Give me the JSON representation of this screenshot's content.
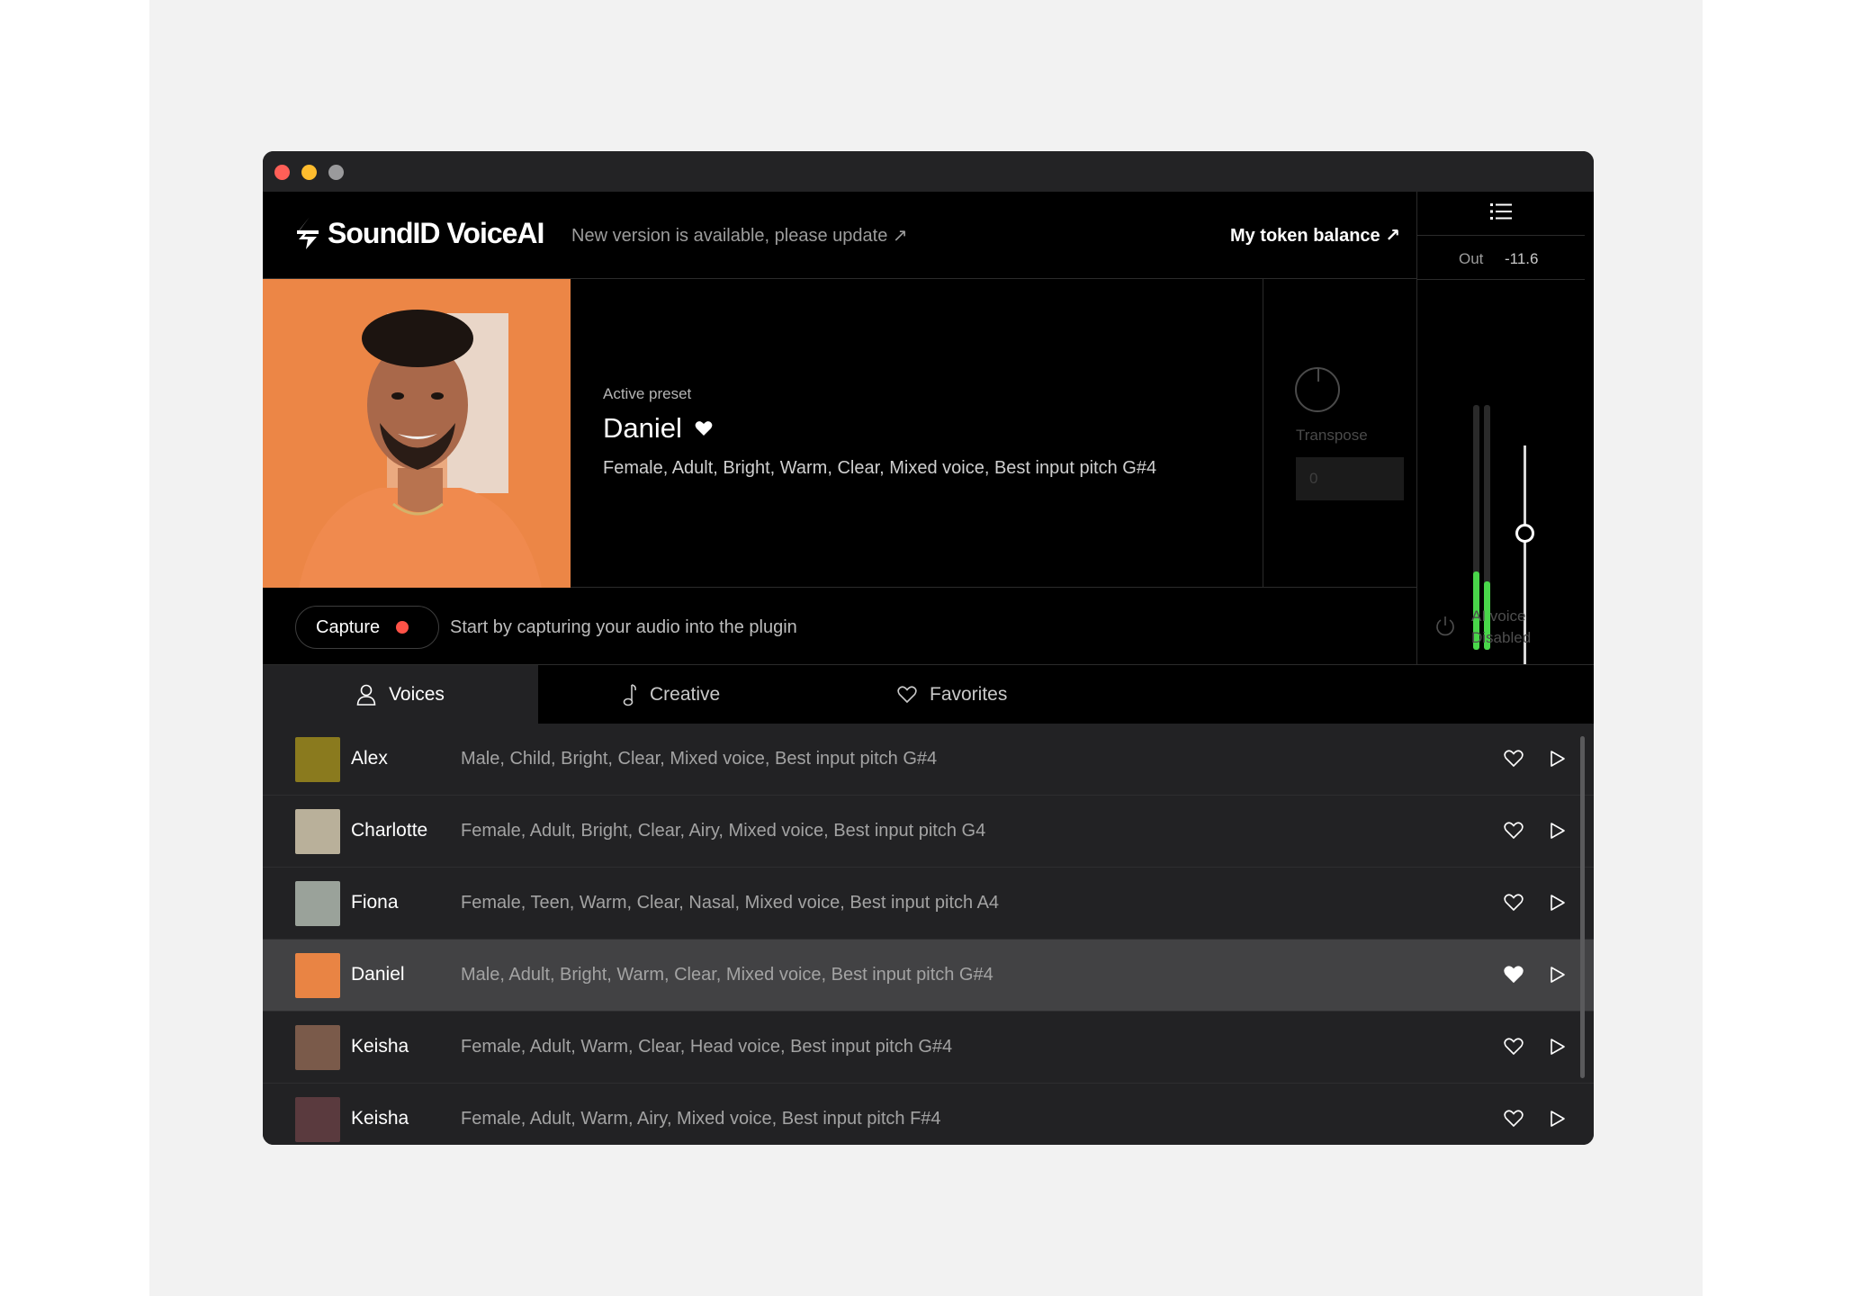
{
  "app": {
    "logo_text": "SoundID VoiceAI",
    "update_notice": "New version is available, please update",
    "token_balance": "My token balance"
  },
  "output": {
    "label": "Out",
    "value": "-11.6",
    "meter_levels": [
      0.32,
      0.28
    ],
    "fader_level": 0.64
  },
  "preset": {
    "label": "Active preset",
    "name": "Daniel",
    "tags": "Female, Adult, Bright, Warm, Clear, Mixed voice, Best input pitch  G#4"
  },
  "transpose": {
    "label": "Transpose",
    "value": "0"
  },
  "capture": {
    "button_label": "Capture",
    "hint": "Start by capturing your audio into the plugin"
  },
  "ai_voice": {
    "title": "AI voice",
    "status": "Disabled"
  },
  "tabs": [
    {
      "label": "Voices",
      "icon": "person-icon",
      "active": true
    },
    {
      "label": "Creative",
      "icon": "music-note-icon",
      "active": false
    },
    {
      "label": "Favorites",
      "icon": "heart-icon",
      "active": false
    }
  ],
  "voices": [
    {
      "name": "Alex",
      "tags": "Male, Child, Bright, Clear, Mixed voice, Best input pitch G#4",
      "favorite": false,
      "active": false,
      "color": "#8a7a1e"
    },
    {
      "name": "Charlotte",
      "tags": "Female, Adult, Bright, Clear, Airy, Mixed voice, Best input pitch  G4",
      "favorite": false,
      "active": false,
      "color": "#b9b09a"
    },
    {
      "name": "Fiona",
      "tags": "Female, Teen, Warm, Clear, Nasal, Mixed voice, Best input pitch  A4",
      "favorite": false,
      "active": false,
      "color": "#9aa29a"
    },
    {
      "name": "Daniel",
      "tags": "Male, Adult, Bright, Warm, Clear, Mixed voice, Best input pitch  G#4",
      "favorite": true,
      "active": true,
      "color": "#e98444"
    },
    {
      "name": "Keisha",
      "tags": "Female, Adult, Warm, Clear, Head voice, Best input pitch  G#4",
      "favorite": false,
      "active": false,
      "color": "#7a5a4a"
    },
    {
      "name": "Keisha",
      "tags": "Female, Adult, Warm, Airy, Mixed voice, Best input pitch  F#4",
      "favorite": false,
      "active": false,
      "color": "#5a3a3e"
    }
  ],
  "colors": {
    "accent_green": "#49d64a",
    "record_red": "#ff5247",
    "hero_orange": "#ec8646"
  }
}
